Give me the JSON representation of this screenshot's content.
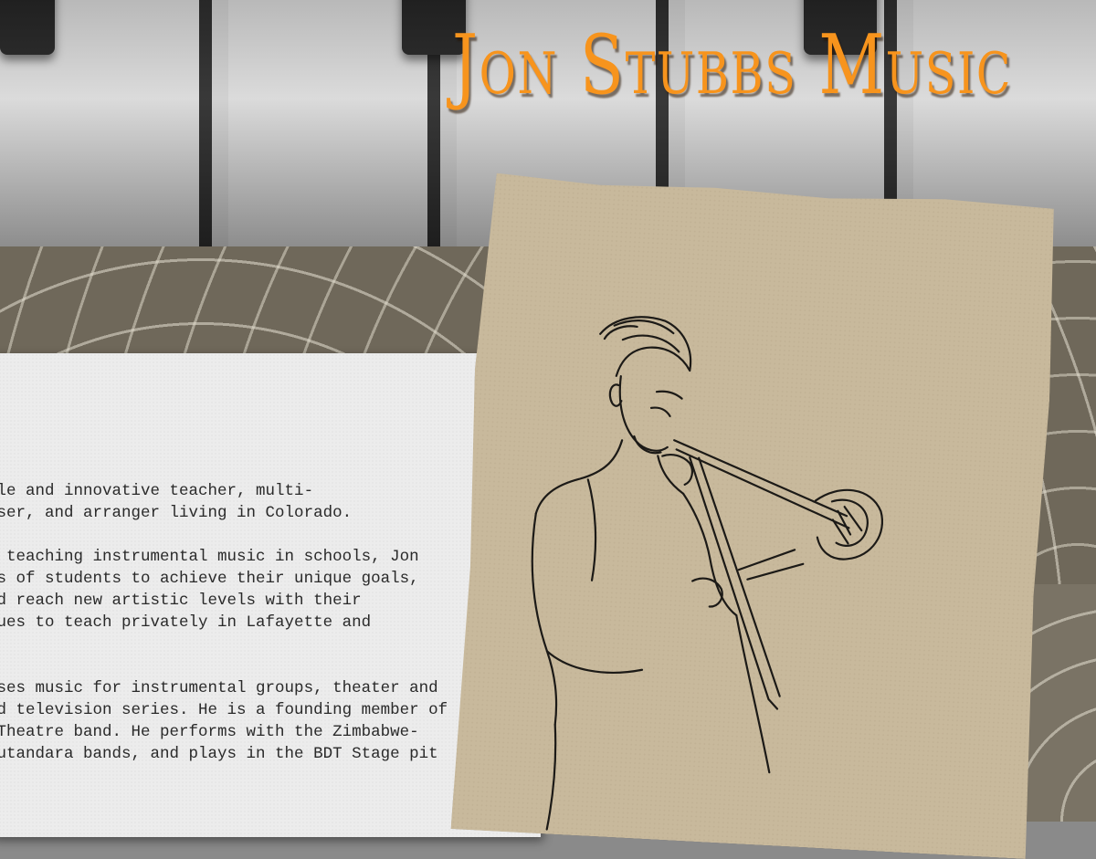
{
  "site": {
    "title": "Jon Stubbs Music"
  },
  "about": {
    "heading": "!",
    "paragraphs": [
      "rsatile and innovative teacher, multi-\ncomposer, and arranger living in Colorado.",
      "rs of teaching instrumental music in schools, Jon\nndreds of students to achieve their unique goals,\ny, and reach new artistic levels with their\nontinues to teach privately in Lafayette and\ns.",
      "composes music for instrumental groups, theater and\ns, and television series. He is a founding member of\nster Theatre band. He performs with the Zimbabwe-\nand Kutandara bands, and plays in the BDT Stage pit"
    ]
  },
  "colors": {
    "title_orange": "#f7941d",
    "sketch_paper": "#c8b99c",
    "pattern_bg": "#6f685a",
    "card_bg": "#ececec"
  },
  "icons": {
    "illustration": "trombone-player-sketch"
  }
}
